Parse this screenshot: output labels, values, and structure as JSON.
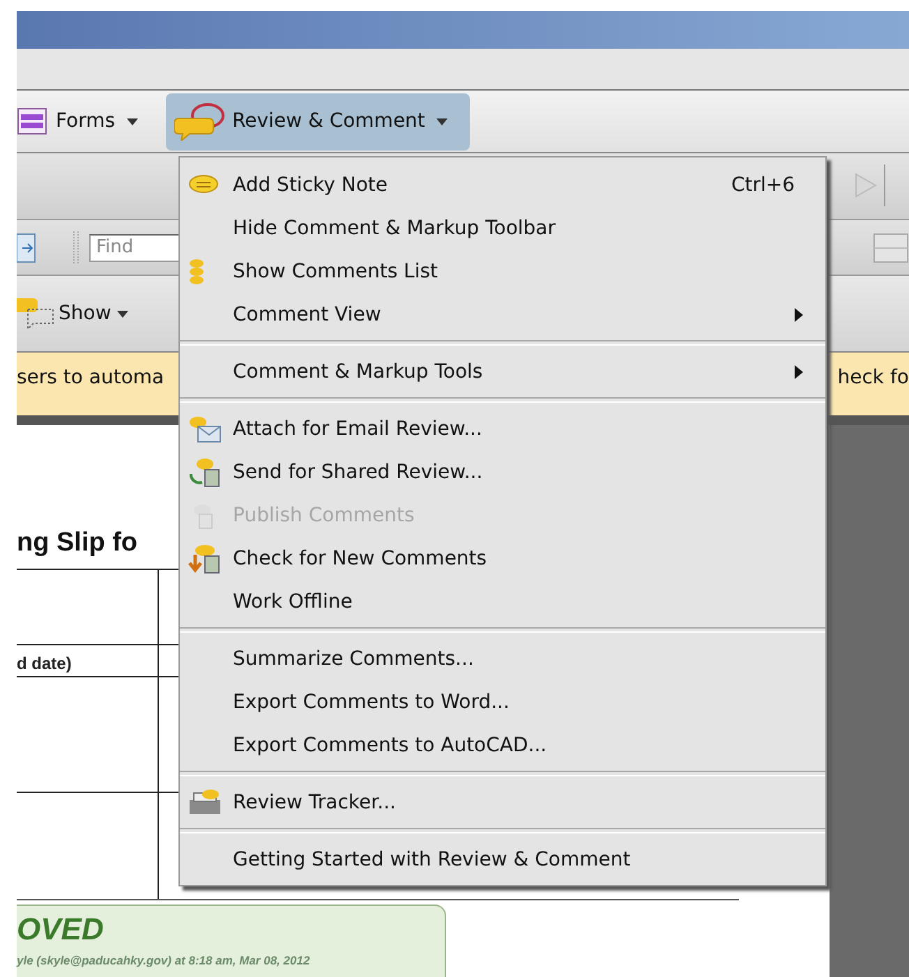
{
  "toolbar": {
    "buttons": [
      {
        "label": "Forms",
        "selected": false,
        "kind": "forms"
      },
      {
        "label": "Review & Comment",
        "selected": true,
        "kind": "review"
      }
    ]
  },
  "find": {
    "placeholder": "Find"
  },
  "show_button": {
    "label": "Show"
  },
  "notice": {
    "left_text": "sers to automa",
    "right_text": "heck fo"
  },
  "document": {
    "heading": "ng Slip fo",
    "cell_text": "d date)"
  },
  "stamp": {
    "title": "OVED",
    "detail": "yle (skyle@paducahky.gov) at 8:18 am, Mar 08, 2012"
  },
  "menu": {
    "sections": [
      [
        {
          "label": "Add Sticky Note",
          "shortcut": "Ctrl+6",
          "submenu": false,
          "disabled": false,
          "kind": "note"
        },
        {
          "label": "Hide Comment & Markup Toolbar",
          "submenu": false,
          "disabled": false,
          "kind": "plain"
        },
        {
          "label": "Show Comments List",
          "submenu": false,
          "disabled": false,
          "kind": "list"
        },
        {
          "label": "Comment View",
          "submenu": true,
          "disabled": false,
          "kind": "plain"
        }
      ],
      [
        {
          "label": "Comment & Markup Tools",
          "submenu": true,
          "disabled": false,
          "kind": "plain"
        }
      ],
      [
        {
          "label": "Attach for Email Review...",
          "submenu": false,
          "disabled": false,
          "kind": "email"
        },
        {
          "label": "Send for Shared Review...",
          "submenu": false,
          "disabled": false,
          "kind": "shared"
        },
        {
          "label": "Publish Comments",
          "submenu": false,
          "disabled": true,
          "kind": "publish"
        },
        {
          "label": "Check for New Comments",
          "submenu": false,
          "disabled": false,
          "kind": "check"
        },
        {
          "label": "Work Offline",
          "submenu": false,
          "disabled": false,
          "kind": "plain"
        }
      ],
      [
        {
          "label": "Summarize Comments...",
          "submenu": false,
          "disabled": false,
          "kind": "plain"
        },
        {
          "label": "Export Comments to Word...",
          "submenu": false,
          "disabled": false,
          "kind": "plain"
        },
        {
          "label": "Export Comments to AutoCAD...",
          "submenu": false,
          "disabled": false,
          "kind": "plain"
        }
      ],
      [
        {
          "label": "Review Tracker...",
          "submenu": false,
          "disabled": false,
          "kind": "tracker"
        }
      ],
      [
        {
          "label": "Getting Started with Review & Comment",
          "submenu": false,
          "disabled": false,
          "kind": "plain"
        }
      ]
    ]
  }
}
